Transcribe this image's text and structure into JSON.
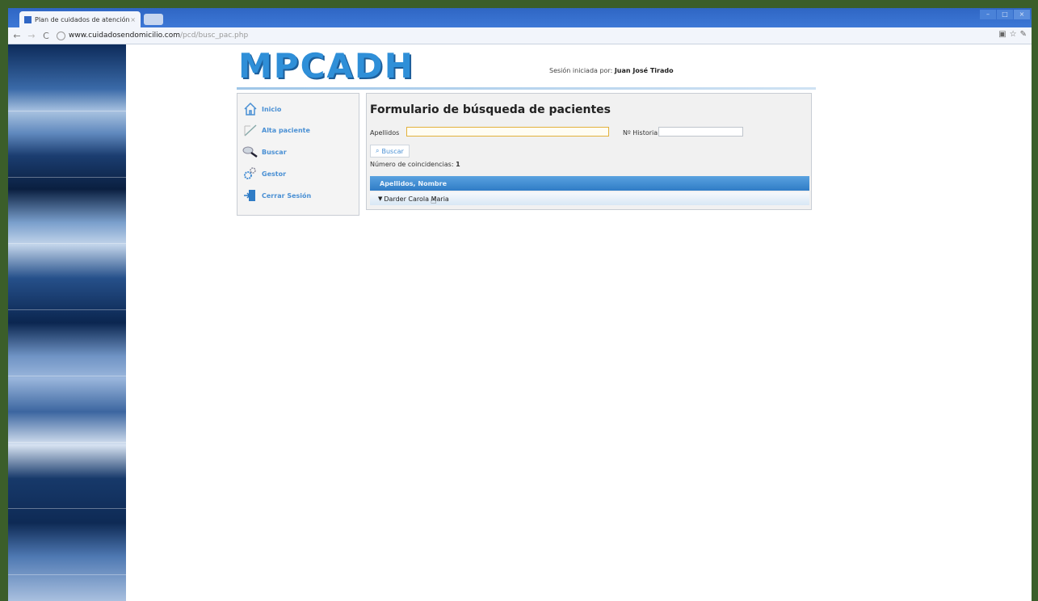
{
  "browser": {
    "tab_title": "Plan de cuidados de atención",
    "tab_close": "×",
    "url_host": "www.cuidadosendomicilio.com",
    "url_path": "/pcd/busc_pac.php",
    "back_icon": "back-arrow-icon",
    "forward_icon": "forward-arrow-icon",
    "reload_icon": "reload-icon"
  },
  "header": {
    "logo_text": "MPCADH",
    "session_prefix": "Sesión iniciada por:",
    "session_user": "Juan José Tirado"
  },
  "nav": {
    "items": [
      {
        "label": "Inicio",
        "icon": "home-icon"
      },
      {
        "label": "Alta paciente",
        "icon": "pen-icon"
      },
      {
        "label": "Buscar",
        "icon": "magnifier-icon"
      },
      {
        "label": "Gestor",
        "icon": "gears-icon"
      },
      {
        "label": "Cerrar Sesión",
        "icon": "logout-door-icon"
      }
    ]
  },
  "form": {
    "title": "Formulario de búsqueda de pacientes",
    "apellidos_label": "Apellidos",
    "apellidos_value": "",
    "historia_label": "Nº Historia",
    "historia_value": "",
    "search_button": "Buscar",
    "count_label": "Número de coincidencias:",
    "count_value": "1"
  },
  "results": {
    "header": "Apellidos, Nombre",
    "rows": [
      "Darder Carola Maria"
    ]
  },
  "colors": {
    "frame": "#3b5e2a",
    "accent": "#2f8fd8",
    "table_header": "#2f7cc6"
  }
}
